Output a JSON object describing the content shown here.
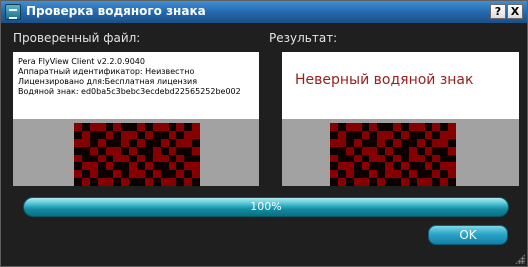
{
  "window": {
    "title": "Проверка водяного знака",
    "help_label": "?",
    "close_label": "X"
  },
  "verified": {
    "label": "Проверенный файл:",
    "info_lines": [
      "Pera FlyView Client v2.2.0.9040",
      "Аппаратный идентификатор: Неизвестно",
      "Лицензировано для:Бесплатная лицензия",
      "Водяной знак: ed0ba5c3bebc3ecdebd22565252be002"
    ]
  },
  "result": {
    "label": "Результат:",
    "message": "Неверный водяной знак"
  },
  "watermark_pattern": [
    "0100101101001010",
    "1011010010110100",
    "0010110101101001",
    "1101001011010110",
    "0110100101001011",
    "1001011010110100",
    "0101101001011010",
    "1010010110100101"
  ],
  "colors": {
    "cell_on": "#0d0000",
    "cell_off": "#860000",
    "result_text": "#9c1c1c",
    "progress": "#39b9cd"
  },
  "progress": {
    "value": 100,
    "text": "100%"
  },
  "buttons": {
    "ok_label": "OK"
  }
}
